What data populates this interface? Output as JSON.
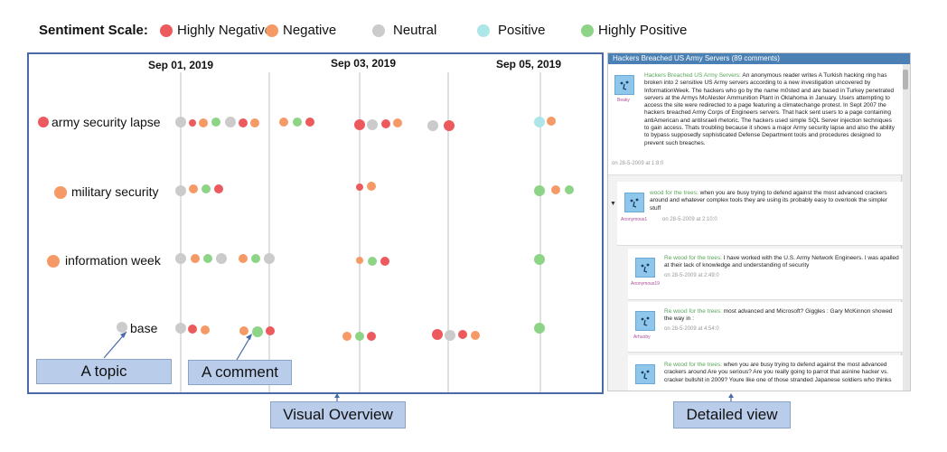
{
  "legend": {
    "title": "Sentiment Scale:",
    "items": [
      {
        "label": "Highly Negative",
        "color": "#ec5a5e"
      },
      {
        "label": "Negative",
        "color": "#f59a66"
      },
      {
        "label": "Neutral",
        "color": "#cbcbcb"
      },
      {
        "label": "Positive",
        "color": "#ace6e8"
      },
      {
        "label": "Highly Positive",
        "color": "#8ed487"
      }
    ]
  },
  "overview": {
    "dates": [
      "Sep 01, 2019",
      "Sep 03, 2019",
      "Sep 05, 2019"
    ],
    "topics": [
      {
        "label": "army security lapse",
        "sentiment": "Highly Negative"
      },
      {
        "label": "military security",
        "sentiment": "Negative"
      },
      {
        "label": "information week",
        "sentiment": "Negative"
      },
      {
        "label": "base",
        "sentiment": "Neutral"
      }
    ]
  },
  "annotations": {
    "topic": "A topic",
    "comment": "A comment",
    "visual_overview": "Visual Overview",
    "detailed_view": "Detailed view"
  },
  "detail": {
    "header": "Hackers Breached US Army Servers (89 comments)",
    "posts": [
      {
        "user": "Beaky",
        "author": "Hackers Breached US Army Servers:",
        "text": " An anonymous reader writes A Turkish hacking ring has broken into 2 sensitive US Army servers according to a new investigation uncovered by InformationWeek. The hackers who go by the name m0sted and are based in Turkey penetrated servers at the Armys McAlester Ammunition Plant in Oklahoma in January. Users attempting to access the site were redirected to a page featuring a climatechange protest. In Sept 2007 the hackers breached Army Corps of Engineers servers. That hack sent users to a page containing antiAmerican and antiIsraeli rhetoric. The hackers used simple SQL Server injection techniques to gain access. Thats troubling because it shows a major Army security lapse and also the ability to bypass supposedly sophisticated Defense Department tools and procedures designed to prevent such breaches.",
        "date": "on 28-5-2009 at 1:8:0"
      },
      {
        "user": "Anonymous1",
        "author": "wood for the trees:",
        "text": " when you are busy trying to defend against the most advanced crackers around and whatever complex tools they are using its probably easy to overlook the simpler stuff",
        "date": "on 28-5-2009 at 2:10:0"
      },
      {
        "user": "Anonymous19",
        "author": "Re wood for the trees:",
        "text": " I have worked with the U.S. Army Network Engineers. I was apalled at their lack of knowledge and understanding of security",
        "date": "on 28-5-2009 at 2:49:0"
      },
      {
        "user": "Arhuoby",
        "author": "Re wood for the trees:",
        "text": " most advanced and Microsoft? Giggles : Gary McKinnon showed the way in :",
        "date": "on 28-5-2009 at 4:54:0"
      },
      {
        "user": "",
        "author": "Re wood for the trees:",
        "text": " when you are busy trying to defend against the most advanced crackers around Are you serious? Are you really going to parrot that asinine hacker vs. cracker bullshit in 2009? Youre like one of those stranded Japanese soldiers who thinks",
        "date": ""
      }
    ]
  }
}
